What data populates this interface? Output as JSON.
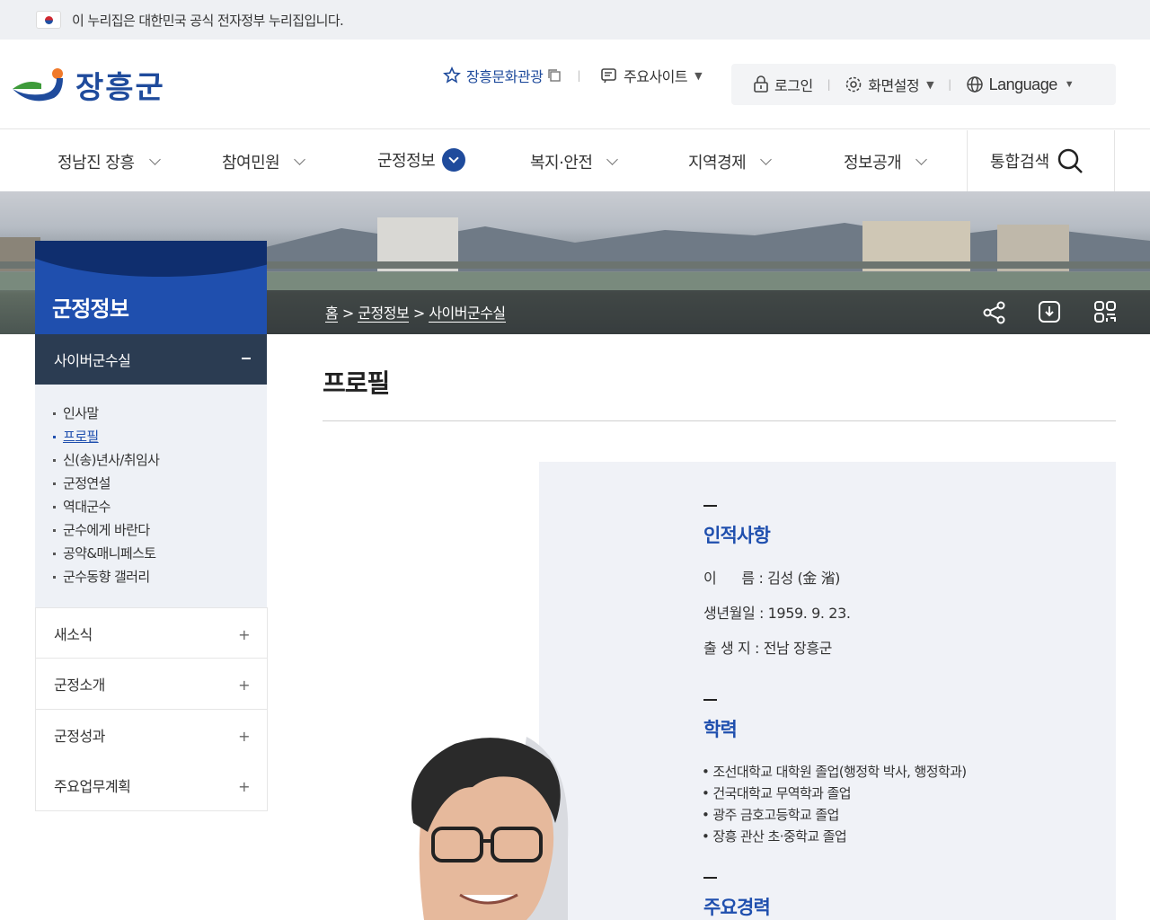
{
  "gov_banner": {
    "text": "이 누리집은 대한민국 공식 전자정부 누리집입니다."
  },
  "header": {
    "logo_text": "장흥군",
    "util": {
      "culture": "장흥문화관광",
      "sites": "주요사이트",
      "login": "로그인",
      "display": "화면설정",
      "language": "Language"
    }
  },
  "gnb": {
    "items": [
      "정남진 장흥",
      "참여민원",
      "군정정보",
      "복지·안전",
      "지역경제",
      "정보공개"
    ],
    "search": "통합검색"
  },
  "breadcrumb": {
    "home": "홈",
    "sep": ">",
    "level1": "군정정보",
    "level2": "사이버군수실"
  },
  "lnb": {
    "title": "군정정보",
    "sub": "사이버군수실",
    "list": [
      "인사말",
      "프로필",
      "신(송)년사/취임사",
      "군정연설",
      "역대군수",
      "군수에게 바란다",
      "공약&매니페스토",
      "군수동향 갤러리"
    ],
    "items": [
      "새소식",
      "군정소개",
      "군정성과",
      "주요업무계획"
    ]
  },
  "content": {
    "title": "프로필",
    "personal": {
      "heading": "인적사항",
      "name": "이      름 : 김성 (金 渻)",
      "birth": "생년월일 : 1959. 9. 23.",
      "birthplace": "출 생 지 : 전남 장흥군"
    },
    "education": {
      "heading": "학력",
      "items": [
        "• 조선대학교 대학원 졸업(행정학 박사, 행정학과)",
        "• 건국대학교 무역학과 졸업",
        "• 광주 금호고등학교 졸업",
        "• 장흥 관산 초·중학교 졸업"
      ]
    },
    "career": {
      "heading": "주요경력"
    }
  },
  "colors": {
    "brand": "#1f4fae",
    "navy": "#2b3c52",
    "panel": "#f0f2f7"
  }
}
